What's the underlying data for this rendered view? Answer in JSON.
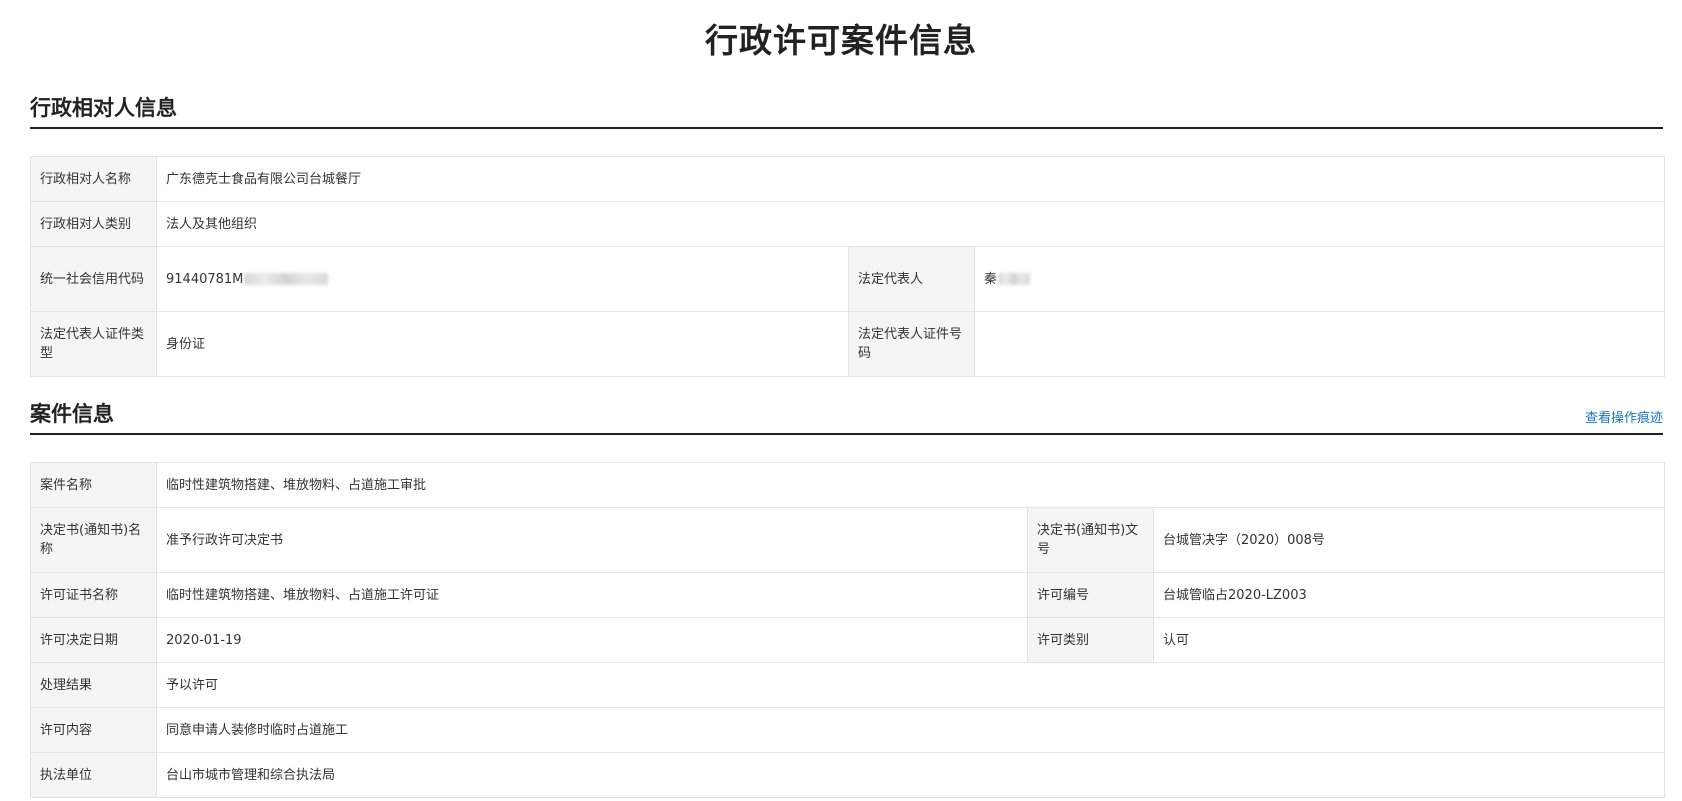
{
  "page": {
    "title": "行政许可案件信息"
  },
  "party_section": {
    "title": "行政相对人信息",
    "rows": {
      "name_label": "行政相对人名称",
      "name_value": "广东德克士食品有限公司台城餐厅",
      "category_label": "行政相对人类别",
      "category_value": "法人及其他组织",
      "credit_code_label": "统一社会信用代码",
      "credit_code_value": "91440781M",
      "legal_rep_label": "法定代表人",
      "legal_rep_value": "秦",
      "id_type_label": "法定代表人证件类型",
      "id_type_value": "身份证",
      "id_number_label": "法定代表人证件号码",
      "id_number_value": ""
    }
  },
  "case_section": {
    "title": "案件信息",
    "trace_link": "查看操作痕迹",
    "rows": {
      "case_name_label": "案件名称",
      "case_name_value": "临时性建筑物搭建、堆放物料、占道施工审批",
      "decision_name_label": "决定书(通知书)名称",
      "decision_name_value": "准予行政许可决定书",
      "decision_no_label": "决定书(通知书)文号",
      "decision_no_value": "台城管决字（2020）008号",
      "license_name_label": "许可证书名称",
      "license_name_value": "临时性建筑物搭建、堆放物料、占道施工许可证",
      "license_no_label": "许可编号",
      "license_no_value": "台城管临占2020-LZ003",
      "decision_date_label": "许可决定日期",
      "decision_date_value": "2020-01-19",
      "license_type_label": "许可类别",
      "license_type_value": "认可",
      "result_label": "处理结果",
      "result_value": "予以许可",
      "content_label": "许可内容",
      "content_value": "同意申请人装修时临时占道施工",
      "unit_label": "执法单位",
      "unit_value": "台山市城市管理和综合执法局"
    }
  }
}
